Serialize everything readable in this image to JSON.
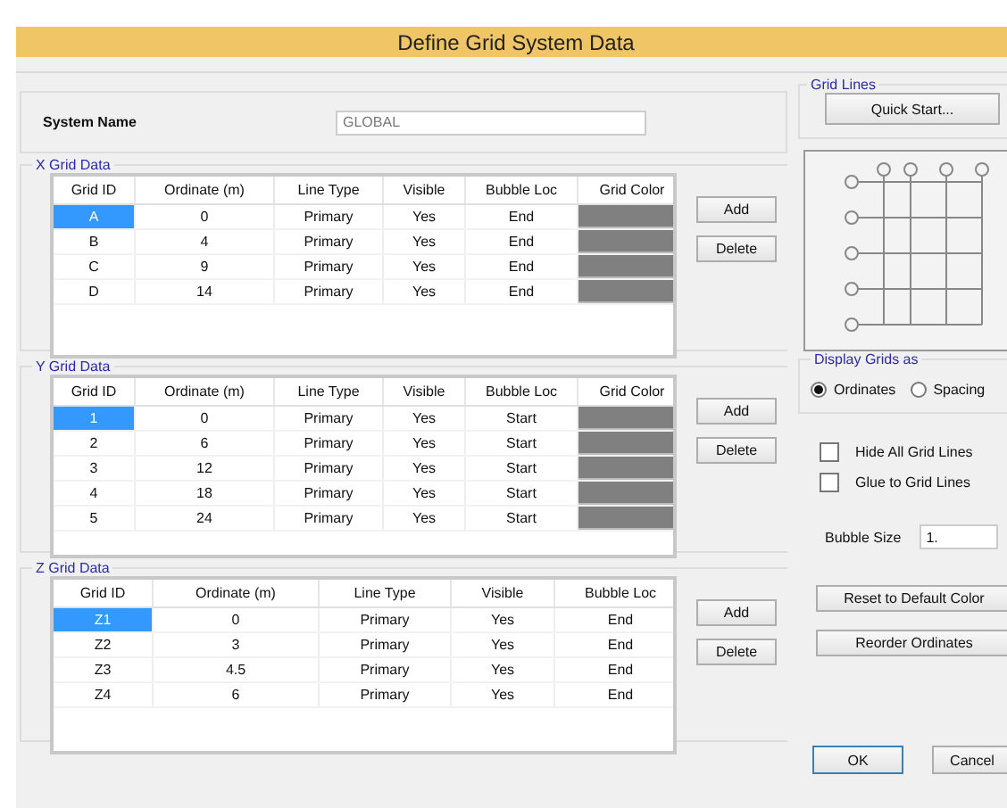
{
  "window": {
    "title": "Define Grid System Data"
  },
  "system_name": {
    "label": "System Name",
    "value": "GLOBAL"
  },
  "grids": [
    {
      "title": "X Grid Data",
      "columns": [
        "Grid ID",
        "Ordinate (m)",
        "Line Type",
        "Visible",
        "Bubble Loc",
        "Grid Color"
      ],
      "buttons": [
        "Add",
        "Delete"
      ],
      "rows": [
        {
          "cells": [
            "A",
            "0",
            "Primary",
            "Yes",
            "End"
          ],
          "color": "#808080",
          "selected": true
        },
        {
          "cells": [
            "B",
            "4",
            "Primary",
            "Yes",
            "End"
          ],
          "color": "#808080",
          "selected": false
        },
        {
          "cells": [
            "C",
            "9",
            "Primary",
            "Yes",
            "End"
          ],
          "color": "#808080",
          "selected": false
        },
        {
          "cells": [
            "D",
            "14",
            "Primary",
            "Yes",
            "End"
          ],
          "color": "#808080",
          "selected": false
        }
      ]
    },
    {
      "title": "Y Grid Data",
      "columns": [
        "Grid ID",
        "Ordinate (m)",
        "Line Type",
        "Visible",
        "Bubble Loc",
        "Grid Color"
      ],
      "buttons": [
        "Add",
        "Delete"
      ],
      "rows": [
        {
          "cells": [
            "1",
            "0",
            "Primary",
            "Yes",
            "Start"
          ],
          "color": "#808080",
          "selected": true
        },
        {
          "cells": [
            "2",
            "6",
            "Primary",
            "Yes",
            "Start"
          ],
          "color": "#808080",
          "selected": false
        },
        {
          "cells": [
            "3",
            "12",
            "Primary",
            "Yes",
            "Start"
          ],
          "color": "#808080",
          "selected": false
        },
        {
          "cells": [
            "4",
            "18",
            "Primary",
            "Yes",
            "Start"
          ],
          "color": "#808080",
          "selected": false
        },
        {
          "cells": [
            "5",
            "24",
            "Primary",
            "Yes",
            "Start"
          ],
          "color": "#808080",
          "selected": false
        }
      ]
    },
    {
      "title": "Z Grid Data",
      "columns": [
        "Grid ID",
        "Ordinate (m)",
        "Line Type",
        "Visible",
        "Bubble Loc"
      ],
      "buttons": [
        "Add",
        "Delete"
      ],
      "rows": [
        {
          "cells": [
            "Z1",
            "0",
            "Primary",
            "Yes",
            "End"
          ],
          "selected": true
        },
        {
          "cells": [
            "Z2",
            "3",
            "Primary",
            "Yes",
            "End"
          ],
          "selected": false
        },
        {
          "cells": [
            "Z3",
            "4.5",
            "Primary",
            "Yes",
            "End"
          ],
          "selected": false
        },
        {
          "cells": [
            "Z4",
            "6",
            "Primary",
            "Yes",
            "End"
          ],
          "selected": false
        }
      ]
    }
  ],
  "grid_lines": {
    "title": "Grid Lines",
    "button": "Quick Start..."
  },
  "display_grids": {
    "title": "Display Grids as",
    "options": [
      {
        "label": "Ordinates",
        "selected": true
      },
      {
        "label": "Spacing",
        "selected": false
      }
    ]
  },
  "checkboxes": [
    {
      "label": "Hide All Grid Lines",
      "checked": false
    },
    {
      "label": "Glue to Grid Lines",
      "checked": false
    }
  ],
  "bubble_size": {
    "label": "Bubble Size",
    "value": "1."
  },
  "side_buttons": [
    "Reset to Default Color",
    "Reorder Ordinates"
  ],
  "footer_buttons": [
    "OK",
    "Cancel"
  ]
}
